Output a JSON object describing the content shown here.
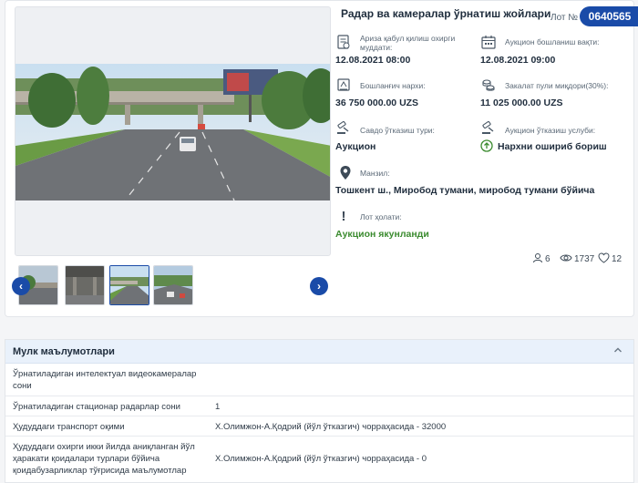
{
  "lot": {
    "title": "Радар ва камералар ўрнатиш жойлари",
    "lot_label": "Лот №",
    "lot_number": "0640565"
  },
  "fields": {
    "application_deadline": {
      "label": "Ариза қабул қилиш охирги муддати:",
      "value": "12.08.2021 08:00"
    },
    "auction_start": {
      "label": "Аукцион бошланиш вақти:",
      "value": "12.08.2021 09:00"
    },
    "start_price": {
      "label": "Бошланғич нархи:",
      "value": "36 750 000.00 UZS"
    },
    "deposit": {
      "label": "Закалат пули миқдори(30%):",
      "value": "11 025 000.00 UZS"
    },
    "trade_type": {
      "label": "Савдо ўтказиш тури:",
      "value": "Аукцион"
    },
    "auction_method": {
      "label": "Аукцион ўтказиш услуби:",
      "value": "Нархни ошириб бориш"
    },
    "address": {
      "label": "Манзил:",
      "value": "Тошкент ш., Миробод тумани, миробод тумани бўйича"
    },
    "lot_status": {
      "label": "Лот ҳолати:",
      "value": "Аукцион якунланди"
    }
  },
  "stats": {
    "participants": "6",
    "views": "1737",
    "likes": "12"
  },
  "colors": {
    "accent": "#1a4ba8",
    "status_green": "#3b8b2f"
  },
  "property": {
    "title": "Мулк маълумотлари",
    "rows": [
      {
        "key": "Ўрнатиладиган интелектуал видеокамералар сони",
        "value": ""
      },
      {
        "key": "Ўрнатиладиган стационар радарлар сони",
        "value": "1"
      },
      {
        "key": "Ҳудуддаги транспорт оқими",
        "value": "Х.Олимжон-А.Қодрий (йўл ўтказгич) чорраҳасида - 32000"
      },
      {
        "key": "Ҳудуддаги охирги икки йилда аниқланган йўл ҳаракати қоидалари турлари бўйича қоидабузарликлар тўғрисида маълумотлар",
        "value": "Х.Олимжон-А.Қодрий (йўл ўтказгич) чорраҳасида - 0"
      }
    ]
  }
}
